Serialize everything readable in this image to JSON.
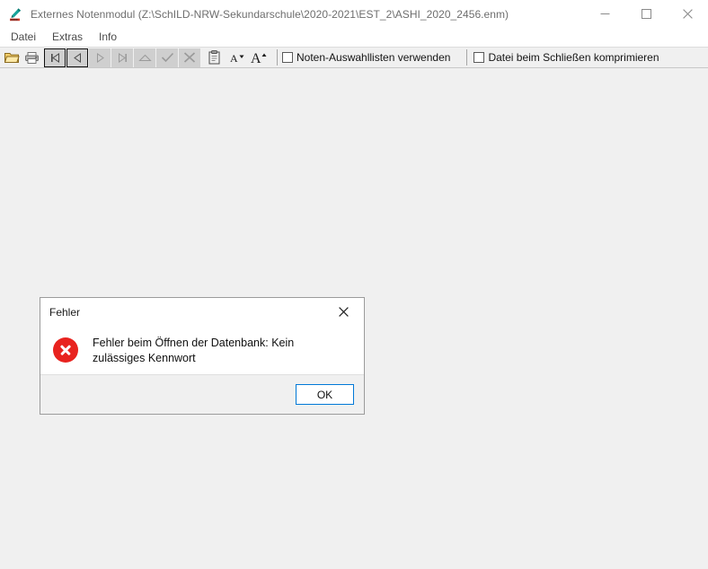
{
  "window": {
    "title": "Externes Notenmodul (Z:\\SchILD-NRW-Sekundarschule\\2020-2021\\EST_2\\ASHI_2020_2456.enm)",
    "app_icon": "pen-icon",
    "controls": [
      {
        "name": "minimize-button",
        "glyph": "minimize-icon"
      },
      {
        "name": "maximize-button",
        "glyph": "maximize-icon"
      },
      {
        "name": "close-button",
        "glyph": "close-icon"
      }
    ]
  },
  "menubar": {
    "items": [
      {
        "label": "Datei"
      },
      {
        "label": "Extras"
      },
      {
        "label": "Info"
      }
    ]
  },
  "toolbar": {
    "buttons": [
      {
        "name": "open-file-button",
        "icon": "open-folder-icon"
      },
      {
        "name": "print-button",
        "icon": "printer-icon"
      },
      {
        "name": "first-record-button",
        "icon": "first-record-icon",
        "state": "bordered"
      },
      {
        "name": "previous-record-button",
        "icon": "previous-record-icon",
        "state": "bordered"
      },
      {
        "name": "next-record-button",
        "icon": "next-record-icon",
        "state": "disabled"
      },
      {
        "name": "last-record-button",
        "icon": "last-record-icon",
        "state": "disabled"
      },
      {
        "name": "insert-record-button",
        "icon": "triangle-up-icon",
        "state": "disabled"
      },
      {
        "name": "confirm-button",
        "icon": "checkmark-icon",
        "state": "disabled"
      },
      {
        "name": "cancel-button",
        "icon": "cross-icon",
        "state": "disabled"
      },
      {
        "name": "clipboard-button",
        "icon": "clipboard-icon"
      }
    ],
    "font_decrease_label": "A",
    "font_increase_label": "A",
    "checkboxes": [
      {
        "name": "use-grade-selection-lists",
        "label": "Noten-Auswahllisten verwenden",
        "checked": false
      },
      {
        "name": "compress-file-on-close",
        "label": "Datei beim Schließen komprimieren",
        "checked": false
      }
    ]
  },
  "dialog": {
    "title": "Fehler",
    "icon": "error-circle-icon",
    "message": "Fehler beim Öffnen der Datenbank: Kein zulässiges Kennwort",
    "ok_label": "OK",
    "close_glyph": "close-icon"
  },
  "colors": {
    "accent": "#0078d7",
    "error": "#e8231f",
    "window_bg": "#f0f0f0",
    "title_text": "#6e6e6e"
  }
}
